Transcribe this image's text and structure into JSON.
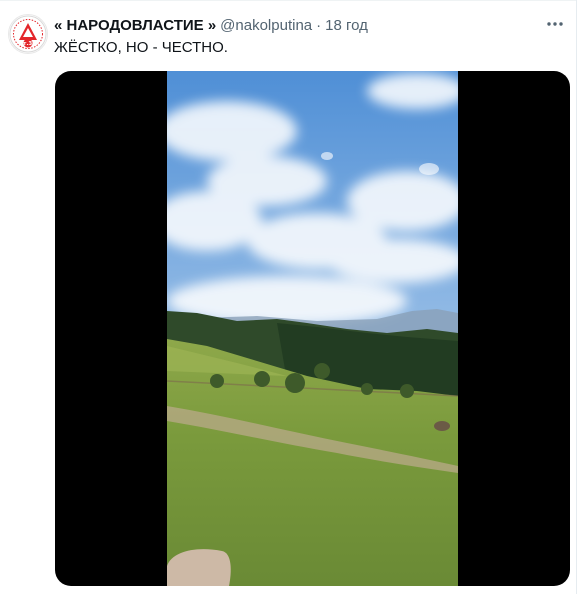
{
  "tweet": {
    "display_name": "« НАРОДОВЛАСТИЕ »",
    "handle": "@nakolputina",
    "separator": "·",
    "time": "18 год",
    "text": "ЖЁСТКО, НО - ЧЕСТНО.",
    "more_icon": "more-horizontal-icon",
    "avatar_icon": "logo-badge-icon",
    "avatar_badge_text": "ст.35"
  },
  "media": {
    "type": "video",
    "scene": "mountain-meadow-landscape"
  },
  "colors": {
    "text_primary": "#0f1419",
    "text_secondary": "#536471",
    "media_background": "#000000",
    "logo_red": "#e3262b"
  }
}
